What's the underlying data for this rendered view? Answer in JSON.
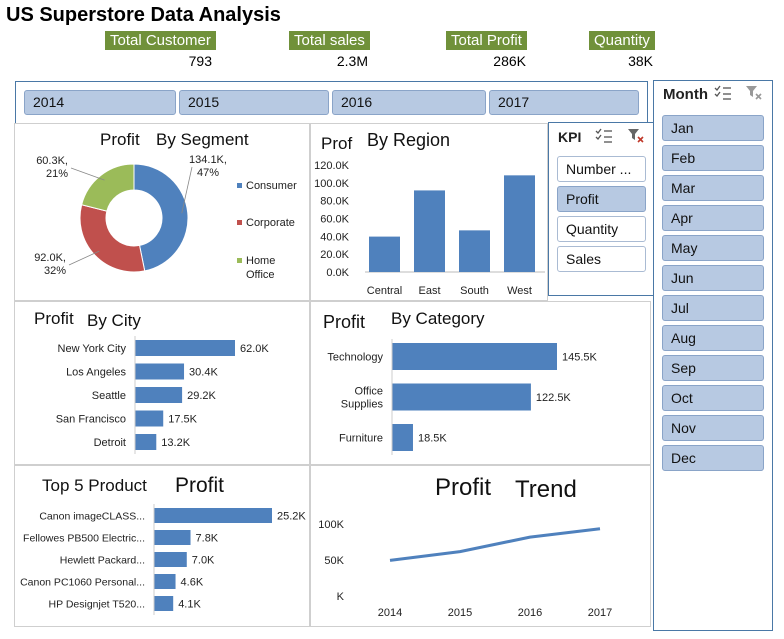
{
  "title": "US Superstore Data Analysis",
  "kpis": [
    {
      "label": "Total Customer",
      "value": "793"
    },
    {
      "label": "Total sales",
      "value": "2.3M"
    },
    {
      "label": "Total Profit",
      "value": "286K"
    },
    {
      "label": "Quantity",
      "value": "38K"
    }
  ],
  "years": [
    "2014",
    "2015",
    "2016",
    "2017"
  ],
  "kpi_slicer": {
    "title": "KPI",
    "options": [
      "Number ...",
      "Profit",
      "Quantity",
      "Sales"
    ],
    "selected": "Profit"
  },
  "month_slicer": {
    "title": "Month",
    "options": [
      "Jan",
      "Feb",
      "Mar",
      "Apr",
      "May",
      "Jun",
      "Jul",
      "Aug",
      "Sep",
      "Oct",
      "Nov",
      "Dec"
    ]
  },
  "colors": {
    "bar": "#4f81bd",
    "consumer": "#4f81bd",
    "corporate": "#c0504d",
    "home_office": "#9bbb59",
    "kpi_label_bg": "#70913a",
    "slicer": "#b7c9e2"
  },
  "panels": {
    "segment": {
      "title_left": "Profit",
      "title_right": "By Segment"
    },
    "region": {
      "title_left": "Prof",
      "title_right": "By Region"
    },
    "city": {
      "title_left": "Profit",
      "title_right": "By  City"
    },
    "category": {
      "title_left": "Profit",
      "title_right": "By Category"
    },
    "products": {
      "title_left": "Top 5 Product",
      "title_right": "Profit"
    },
    "trend": {
      "title_left": "Profit",
      "title_right": "Trend"
    }
  },
  "chart_data": [
    {
      "id": "segment",
      "type": "pie",
      "categories": [
        "Consumer",
        "Corporate",
        "Home Office"
      ],
      "values": [
        134.1,
        92.0,
        60.3
      ],
      "labels": [
        "134.1K,\n47%",
        "92.0K,\n32%",
        "60.3K,\n21%"
      ],
      "legend_labels": [
        "Consumer",
        "Corporate",
        "Home\nOffice"
      ],
      "legend": "right"
    },
    {
      "id": "region",
      "type": "bar",
      "categories": [
        "Central",
        "East",
        "South",
        "West"
      ],
      "values": [
        39.7,
        91.5,
        46.7,
        108.4
      ],
      "ylim": [
        0,
        120
      ],
      "yticks": [
        "0.0K",
        "20.0K",
        "40.0K",
        "60.0K",
        "80.0K",
        "100.0K",
        "120.0K"
      ]
    },
    {
      "id": "city",
      "type": "bar",
      "orientation": "horizontal",
      "categories": [
        "New York City",
        "Los Angeles",
        "Seattle",
        "San Francisco",
        "Detroit"
      ],
      "values": [
        62.0,
        30.4,
        29.2,
        17.5,
        13.2
      ],
      "data_labels": [
        "62.0K",
        "30.4K",
        "29.2K",
        "17.5K",
        "13.2K"
      ]
    },
    {
      "id": "category",
      "type": "bar",
      "orientation": "horizontal",
      "categories": [
        "Technology",
        "Office\nSupplies",
        "Furniture"
      ],
      "values": [
        145.5,
        122.5,
        18.5
      ],
      "data_labels": [
        "145.5K",
        "122.5K",
        "18.5K"
      ]
    },
    {
      "id": "products",
      "type": "bar",
      "orientation": "horizontal",
      "categories": [
        "Canon imageCLASS...",
        "Fellowes PB500 Electric...",
        "Hewlett Packard...",
        "Canon PC1060 Personal...",
        "HP Designjet T520..."
      ],
      "values": [
        25.2,
        7.8,
        7.0,
        4.6,
        4.1
      ],
      "data_labels": [
        "25.2K",
        "7.8K",
        "7.0K",
        "4.6K",
        "4.1K"
      ]
    },
    {
      "id": "trend",
      "type": "line",
      "x": [
        "2014",
        "2015",
        "2016",
        "2017"
      ],
      "values": [
        49.5,
        61.6,
        81.8,
        93.4
      ],
      "ylim": [
        0,
        100
      ],
      "yticks": [
        "K",
        "50K",
        "100K"
      ]
    }
  ]
}
